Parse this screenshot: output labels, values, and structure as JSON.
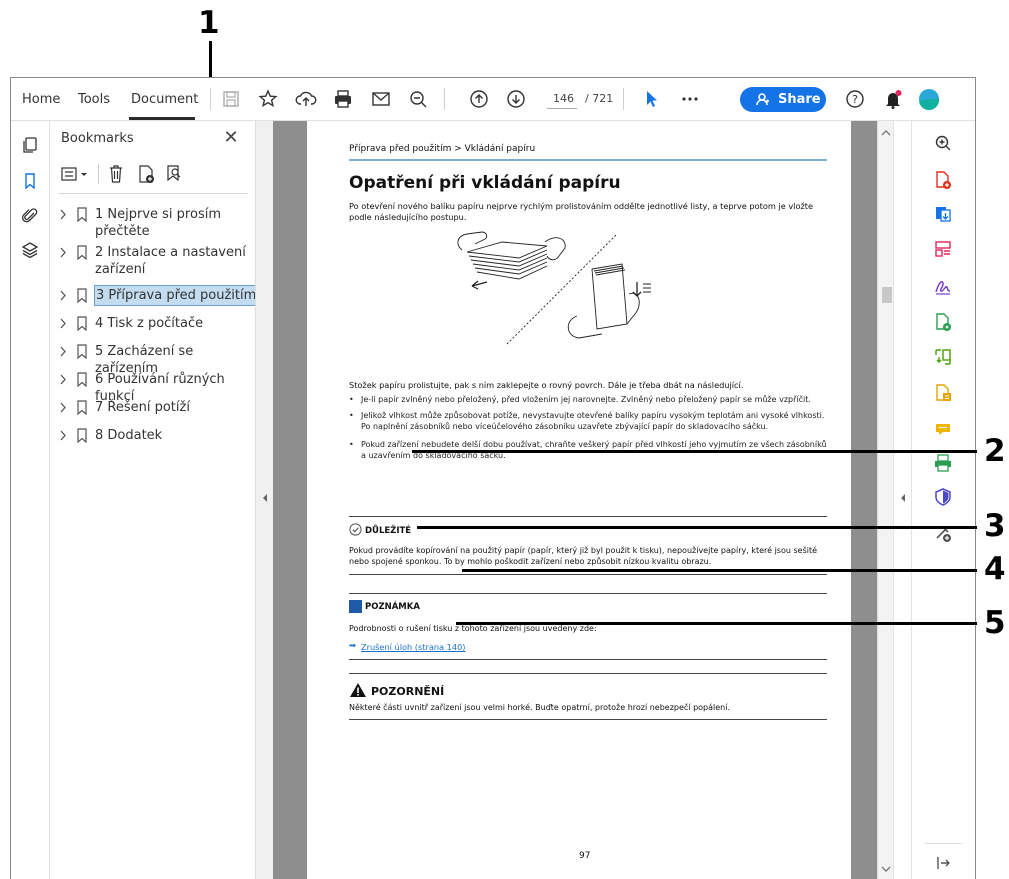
{
  "callouts": [
    "1",
    "2",
    "3",
    "4",
    "5"
  ],
  "menu": {
    "home": "Home",
    "tools": "Tools",
    "document": "Document"
  },
  "toolbar": {
    "page_current": "146",
    "page_total": "/ 721",
    "share_label": "Share"
  },
  "bookmarks_panel": {
    "title": "Bookmarks",
    "close": "✕",
    "items": [
      {
        "label": "1 Nejprve si prosím přečtěte",
        "line1": "1 Nejprve si prosím",
        "line2": "přečtěte"
      },
      {
        "label": "2 Instalace a nastavení zařízení",
        "line1": "2 Instalace a nastavení",
        "line2": "zařízení"
      },
      {
        "label": "3 Příprava před použitím",
        "selected": true
      },
      {
        "label": "4 Tisk z počítače"
      },
      {
        "label": "5 Zacházení se zařízením"
      },
      {
        "label": "6 Používání různých funkcí"
      },
      {
        "label": "7 Řešení potíží"
      },
      {
        "label": "8 Dodatek"
      }
    ]
  },
  "document": {
    "breadcrumb": "Příprava před použitím > Vkládání papíru",
    "heading": "Opatření při vkládání papíru",
    "intro": "Po otevření nového balíku papíru nejprve rychlým prolistováním oddělte jednotlivé listy, a teprve potom je vložte podle následujícího postupu.",
    "para2": "Stožek papíru prolistujte, pak s ním zaklepejte o rovný povrch. Dále je třeba dbát na následující.",
    "bullets": [
      "Je-li papír zvlněný nebo přeložený, před vložením jej narovnejte. Zvlněný nebo přeložený papír se může vzpříčit.",
      "Jelikož vlhkost může způsobovat potíže, nevystavujte otevřené balíky papíru vysokým teplotám ani vysoké vlhkosti. Po naplnění zásobníků nebo víceúčelového zásobníku uzavřete zbývající papír do skladovacího sáčku.",
      "Pokud zařízení nebudete delší dobu používat, chraňte veškerý papír před vlhkostí jeho vyjmutím ze všech zásobníků a uzavřením do skladovacího sáčku."
    ],
    "important_title": "DŮLEŽITÉ",
    "important_text": "Pokud provádíte kopírování na použitý papír (papír, který již byl použit k tisku), nepoužívejte papíry, které jsou sešité nebo spojené sponkou. To by mohlo poškodit zařízení nebo způsobit nízkou kvalitu obrazu.",
    "note_title": "POZNÁMKA",
    "note_text": "Podrobnosti o rušení tisku z tohoto zařízení jsou uvedeny zde:",
    "note_link_arrow": "➡",
    "note_link": "Zrušení úloh (strana 140)",
    "warning_title": "POZORNĚNÍ",
    "warning_text": "Některé části uvnitř zařízení jsou velmi horké. Buďte opatrní, protože hrozí nebezpečí popálení.",
    "page_number": "97"
  },
  "colors": {
    "accent": "#1473e6",
    "selection": "#c4dcf0",
    "link": "#1a73c8",
    "note_icon": "#1e5aa8",
    "rule_blue": "#7fb0d4"
  },
  "icons": {
    "toolbar": [
      "save-icon",
      "star-icon",
      "cloud-upload-icon",
      "print-icon",
      "email-icon",
      "zoom-out-icon",
      "page-up-icon",
      "page-down-icon",
      "select-cursor-icon",
      "more-icon",
      "help-icon",
      "notification-icon",
      "profile-icon"
    ],
    "left_rail": [
      "page-thumbnails-icon",
      "bookmark-icon",
      "attachment-icon",
      "layers-icon"
    ],
    "right_tools": [
      "zoom-icon",
      "create-pdf-icon",
      "export-pdf-icon",
      "organize-pages-icon",
      "fill-sign-icon",
      "edit-pdf-icon",
      "compress-icon",
      "request-signature-icon",
      "comment-icon",
      "scan-icon",
      "protect-icon",
      "more-tools-icon",
      "collapse-panel-icon"
    ]
  }
}
